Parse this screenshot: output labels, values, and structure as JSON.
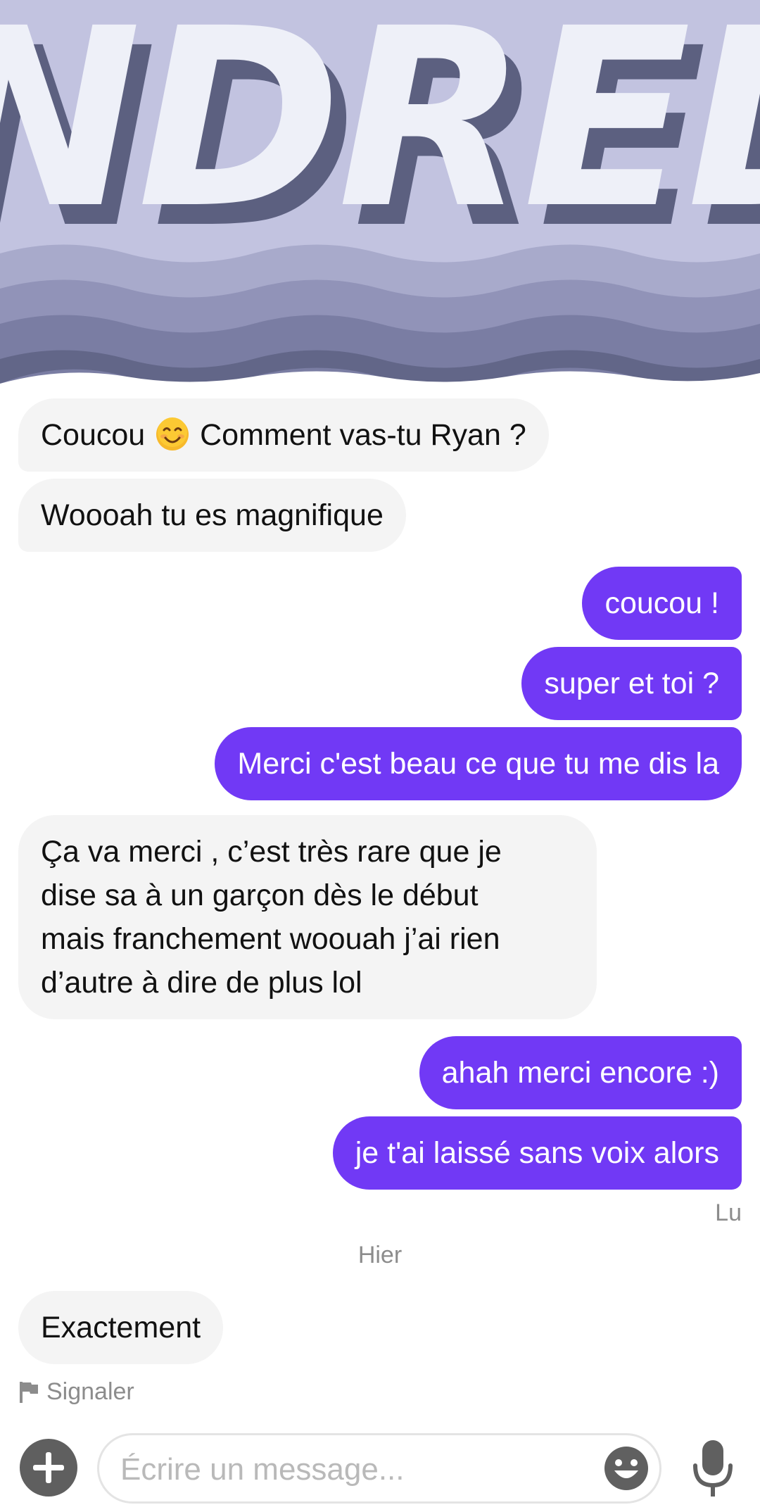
{
  "banner": {
    "text": "NDRED"
  },
  "messages": [
    {
      "direction": "incoming",
      "parts": [
        "Coucou ",
        " Comment vas-tu Ryan ?"
      ],
      "emoji": "smiling-face-emoji"
    },
    {
      "direction": "incoming",
      "text": "Woooah tu es magnifique"
    },
    {
      "direction": "outgoing",
      "text": "coucou !"
    },
    {
      "direction": "outgoing",
      "text": "super et toi ?"
    },
    {
      "direction": "outgoing",
      "text": "Merci c'est beau ce que tu me dis la"
    },
    {
      "direction": "incoming",
      "lines": [
        "Ça va merci , c’est très rare que je",
        "dise sa à un garçon dès le début",
        "mais franchement woouah j’ai rien",
        "d’autre à dire de plus lol"
      ]
    },
    {
      "direction": "outgoing",
      "text": "ahah merci encore :)"
    },
    {
      "direction": "outgoing",
      "text": "je t'ai laissé sans voix alors"
    },
    {
      "direction": "incoming",
      "text": "Exactement"
    }
  ],
  "read_status": "Lu",
  "date_separator": "Hier",
  "report_label": "Signaler",
  "composer": {
    "placeholder": "Écrire un message..."
  },
  "icons": {
    "add": "plus-circle-icon",
    "emoji": "smiley-icon",
    "mic": "microphone-icon",
    "report": "flag-icon"
  },
  "colors": {
    "outgoing_bubble": "#7139f5",
    "incoming_bubble": "#f4f4f4",
    "banner_background": "#c2c3e0",
    "banner_letters": "#eef0f8",
    "banner_shadow": "#5c6080"
  }
}
